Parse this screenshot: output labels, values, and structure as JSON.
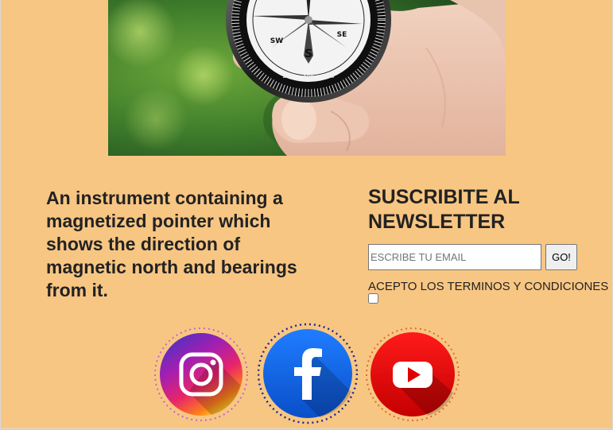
{
  "hero": {
    "image": "compass-in-hand-photo"
  },
  "tagline": "An instrument containing a magnetized pointer which shows the direction of magnetic north and bearings from it.",
  "newsletter": {
    "title": "SUSCRIBITE AL NEWSLETTER",
    "email_placeholder": "ESCRIBE TU EMAIL",
    "submit_label": "GO!",
    "terms_label": "ACEPTO LOS TERMINOS Y CONDICIONES"
  },
  "social": [
    {
      "name": "instagram",
      "icon": "instagram-icon",
      "color": "#c13584"
    },
    {
      "name": "facebook",
      "icon": "facebook-icon",
      "color": "#1264d6"
    },
    {
      "name": "youtube",
      "icon": "youtube-icon",
      "color": "#e00000"
    }
  ],
  "colors": {
    "page_background": "#f8c683",
    "text": "#222222"
  }
}
